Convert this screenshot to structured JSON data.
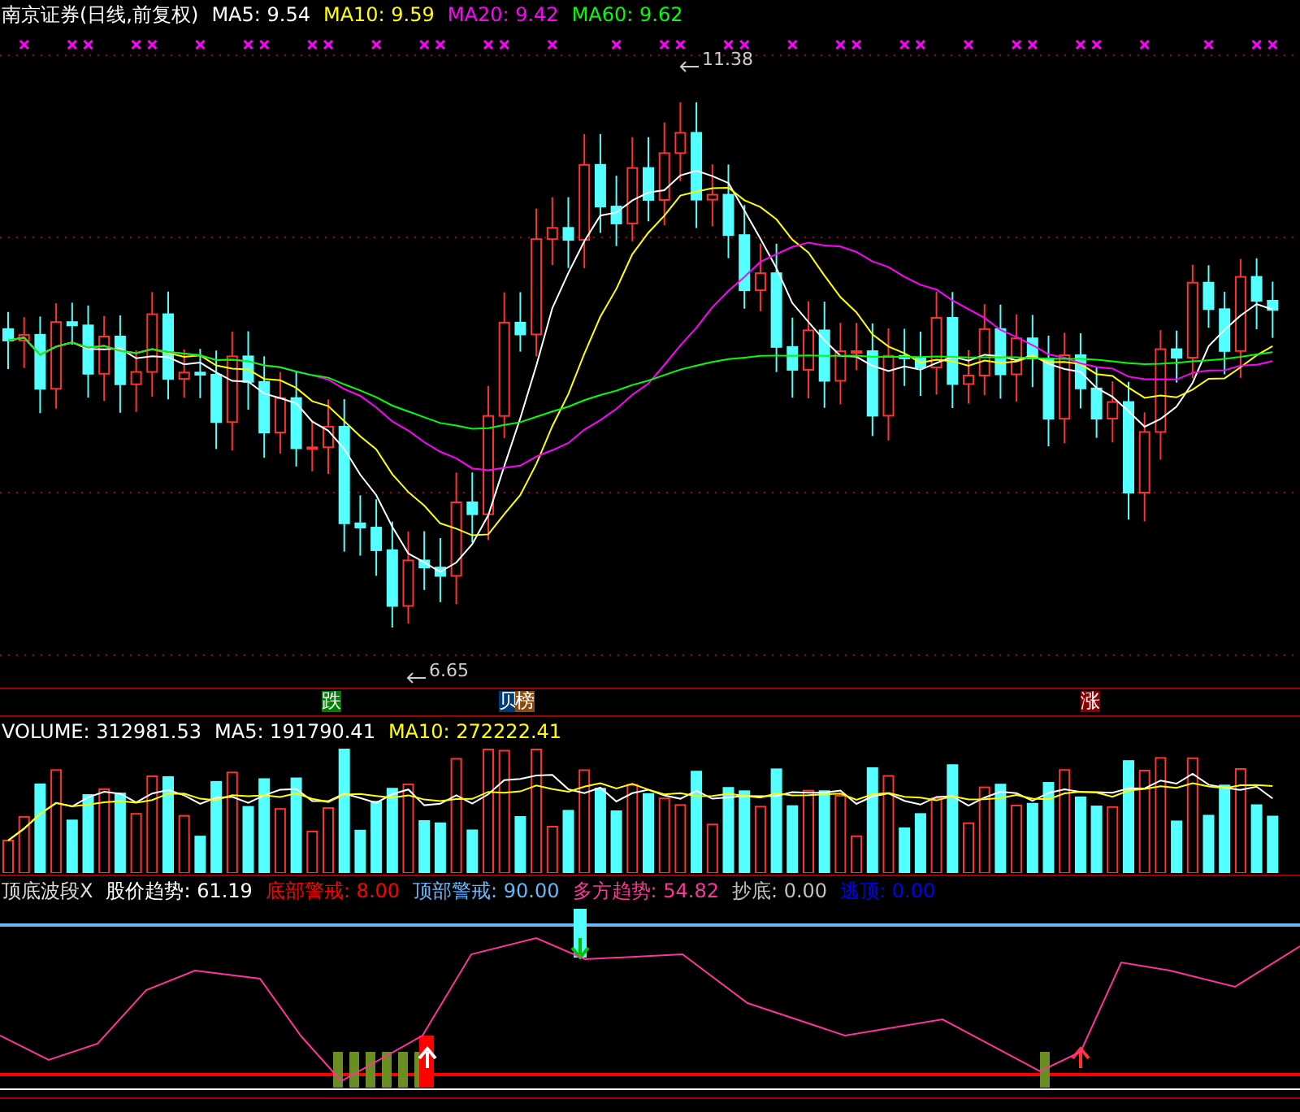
{
  "price_panel": {
    "title": "南京证券(日线,前复权)",
    "legend": [
      {
        "text": "MA5: 9.54",
        "color": "#ffffff"
      },
      {
        "text": "MA10: 9.59",
        "color": "#ffff00"
      },
      {
        "text": "MA20: 9.42",
        "color": "#ff00ff"
      },
      {
        "text": "MA60: 9.62",
        "color": "#00ff00"
      }
    ],
    "high_label": "11.38",
    "low_label": "6.65",
    "markers": [
      {
        "text": "跌",
        "color": "#008000"
      },
      {
        "text": "贝",
        "color": "#003c78"
      },
      {
        "text": "榜",
        "color": "#8b4a10"
      },
      {
        "text": "涨",
        "color": "#8b0000"
      }
    ]
  },
  "volume_panel": {
    "legend": [
      {
        "text": "VOLUME: 312981.53",
        "color": "#ffffff"
      },
      {
        "text": "MA5: 191790.41",
        "color": "#ffffff"
      },
      {
        "text": "MA10: 272222.41",
        "color": "#ffff00"
      }
    ]
  },
  "indicator_panel": {
    "title": "顶底波段X",
    "legend": [
      {
        "text": "股价趋势: 61.19",
        "color": "#ffffff"
      },
      {
        "text": "底部警戒: 8.00",
        "color": "#ff0000"
      },
      {
        "text": "顶部警戒: 90.00",
        "color": "#66b8ff"
      },
      {
        "text": "多方趋势: 54.82",
        "color": "#ff3399"
      },
      {
        "text": "抄底: 0.00",
        "color": "#c0c0c0"
      },
      {
        "text": "逃顶: 0.00",
        "color": "#0000ff"
      }
    ]
  }
}
